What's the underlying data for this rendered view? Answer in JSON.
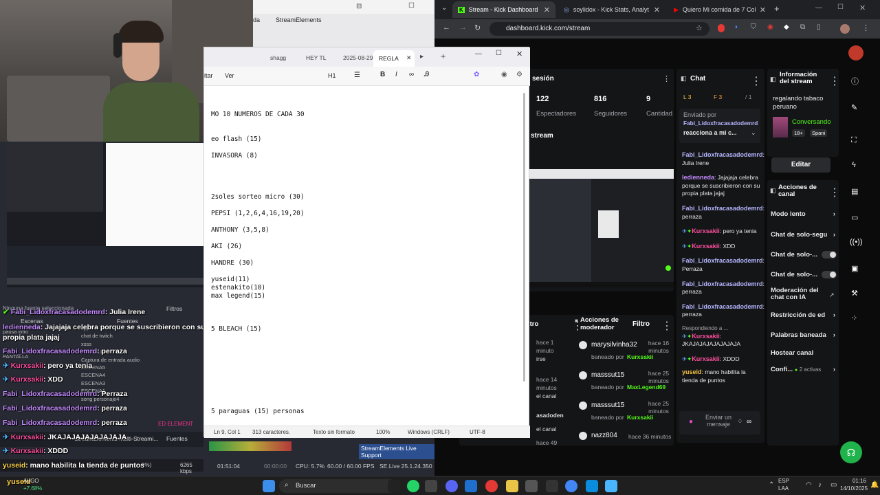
{
  "browser": {
    "tabs": [
      {
        "label": "Stream - Kick Dashboard",
        "active": true
      },
      {
        "label": "soylidox - Kick Stats, Analytics",
        "active": false
      },
      {
        "label": "Quiero Mi comida de 7 Colores",
        "active": false
      }
    ],
    "url": "dashboard.kick.com/stream"
  },
  "kick": {
    "session": {
      "title": "sesión",
      "stats": [
        {
          "value": "122",
          "label": "Espectadores"
        },
        {
          "value": "816",
          "label": "Seguidores"
        },
        {
          "value": "9",
          "label": "Cantidad suscrip"
        }
      ],
      "stream_label": "stream"
    },
    "chat": {
      "title": "Chat",
      "badges": [
        "L 3",
        "F 3",
        "/ 1"
      ],
      "pinned_label": "Enviado por",
      "pinned_user": "Fabi_Lidoxfracasadodemrd",
      "pinned_text": "reacciona a mi c...",
      "messages": [
        {
          "user": "Fabi_Lidoxfracasadodemrd",
          "text": ": Julia Irene"
        },
        {
          "user": "ledienneda",
          "text": ": Jajajaja celebra porque se suscribieron con su propia plata jajaj"
        },
        {
          "user": "Fabi_Lidoxfracasadodemrd",
          "text": ": perraza"
        },
        {
          "user": "Kurxsakii",
          "text": ": pero ya tenia"
        },
        {
          "user": "Kurxsakii",
          "text": ": XDD"
        },
        {
          "user": "Fabi_Lidoxfracasadodemrd",
          "text": ": Perraza"
        },
        {
          "user": "Fabi_Lidoxfracasadodemrd",
          "text": ": perraza"
        },
        {
          "user": "Fabi_Lidoxfracasadodemrd",
          "text": ": perraza"
        },
        {
          "user": "Kurxsakii",
          "text": ": JKAJAJAJAJAJAJAJA"
        },
        {
          "user": "Kurxsakii",
          "text": ": XDDD"
        },
        {
          "user": "yuseid",
          "text": ": mano habilita la tienda de puntos"
        }
      ],
      "replying": "Respondiendo a ...",
      "send_placeholder": "Enviar un mensaje"
    },
    "info": {
      "title": "Información del stream",
      "stream_title": "regalando tabaco peruano",
      "category": "Conversando",
      "age": "18+",
      "lang": "Spani",
      "edit": "Editar"
    },
    "actions": {
      "title": "Acciones de canal",
      "items": [
        "Modo lento",
        "Chat de solo-segu",
        "Chat de solo-...",
        "Chat de solo-...",
        "Moderación del chat con IA",
        "Restricción de ed",
        "Palabras baneada",
        "Hostear canal",
        "Confi..."
      ],
      "active_count": "2 activas"
    },
    "mod": {
      "title": "Acciones de moderador",
      "filter": "Filtro",
      "filter_left": "ltro",
      "entries": [
        {
          "user": "marysilvinha32",
          "by_label": "baneado por",
          "by": "Kurxsakii",
          "time": "hace 16 minutos"
        },
        {
          "user": "masssut15",
          "by_label": "baneado por",
          "by": "MaxLegend69",
          "time": "hace 25 minutos"
        },
        {
          "user": "masssut15",
          "by_label": "baneado por",
          "by": "Kurxsakii",
          "time": "hace 25 minutos"
        },
        {
          "user": "nazz804",
          "by_label": "",
          "by": "",
          "time": "hace 36 minutos"
        }
      ],
      "left_items": [
        "hace 1 minuto",
        "irse",
        "hace 14 minutos",
        "el canal",
        "asadoden",
        "el canal",
        "hace 49"
      ]
    }
  },
  "notepad": {
    "tabs": [
      "shagg",
      "HEY TL",
      "2025-08-29.",
      "REGLA"
    ],
    "menu": [
      "itar",
      "Ver",
      "H1"
    ],
    "lines": [
      "MO 10 NUMEROS DE CADA 30",
      "",
      "",
      "eo flash (15)",
      "",
      "INVASORA (8)",
      "",
      "",
      "",
      "",
      "2soles sorteo micro (30)",
      "",
      "PEPSI (1,2,6,4,16,19,20)",
      "",
      "ANTHONY (3,5,8)",
      "",
      "AKI (26)",
      "",
      "HANDRE (30)",
      "",
      "yuseid(11)",
      "estenakito(10)",
      "max legend(15)",
      "",
      "",
      "",
      "5 BLEACH (15)",
      "",
      "",
      "",
      "",
      "",
      "",
      "",
      "",
      "",
      "5 paraguas (15) personas"
    ],
    "status": {
      "position": "Ln 9, Col 1",
      "chars": "313 caracteres.",
      "format": "Texto sin formato",
      "zoom": "100%",
      "eol": "Windows (CRLF)",
      "encoding": "UTF-8"
    }
  },
  "obs": {
    "title_app": "StreamElements",
    "menu_left": "da",
    "scene_labels": [
      "Escenas",
      "Fuentes",
      "Filtros"
    ],
    "no_source": "Ninguna fuente seleccionada",
    "sources": [
      "pausa intro",
      "cpp",
      "chat de twitch",
      "xsss",
      "PANTALLA",
      "Captura de entrada audio",
      "ESCENA5",
      "ESCENA4",
      "ESCENA3",
      "ESCENA1",
      "song personaje4"
    ],
    "overlay_chat": [
      {
        "user": "Fabi_Lidoxfracasadodemrd",
        "text": ": Julia Irene",
        "color": "#b36bff"
      },
      {
        "user": "ledienneda",
        "text": ": Jajajaja celebra porque se suscribieron con su",
        "color": "#b36bff"
      },
      {
        "user": "",
        "text": "propia plata jajaj",
        "color": ""
      },
      {
        "user": "Fabi_Lidoxfracasadodemrd",
        "text": ": perraza",
        "color": "#b36bff"
      },
      {
        "user": "Kurxsakii",
        "text": ": pero ya tenia",
        "color": "#ff4fa0"
      },
      {
        "user": "Kurxsakii",
        "text": ": XDD",
        "color": "#ff4fa0"
      },
      {
        "user": "Fabi_Lidoxfracasadodemrd",
        "text": ": Perraza",
        "color": "#b36bff"
      },
      {
        "user": "Fabi_Lidoxfracasadodemrd",
        "text": ": perraza",
        "color": "#b36bff"
      },
      {
        "user": "Fabi_Lidoxfracasadodemrd",
        "text": ": perraza",
        "color": "#b36bff"
      },
      {
        "user": "Kurxsakii",
        "text": ": JKAJAJAJAJAJAJAJA",
        "color": "#ff4fa0"
      },
      {
        "user": "Kurxsakii",
        "text": ": XDDD",
        "color": "#ff4fa0"
      },
      {
        "user": "yuseid",
        "text": ": mano habilita la tienda de puntos",
        "color": "#ffd24a"
      }
    ],
    "status": {
      "time1": "01:51:04",
      "time2": "00:00:00",
      "cpu": "CPU: 5.7%",
      "fps": "60.00 / 60.00 FPS",
      "kbps": "6265 kbps",
      "version": "SE.Live 25.1.24.350",
      "drop": "0%)",
      "se_bar": "StreamElements Multi-Streami...",
      "se_support": "StreamElements Live Support",
      "fuentes": "Fuentes",
      "ed_element": "ED ELEMENT"
    }
  },
  "taskbar": {
    "weather_name": "AVGO",
    "weather_value": "+7.68%",
    "search": "Buscar",
    "lang1": "ESP",
    "lang2": "LAA",
    "time": "01:16",
    "date": "14/10/2025"
  },
  "colors": {
    "kick_green": "#53fc18",
    "bg": "#0b0b0b",
    "panel": "#141517"
  }
}
